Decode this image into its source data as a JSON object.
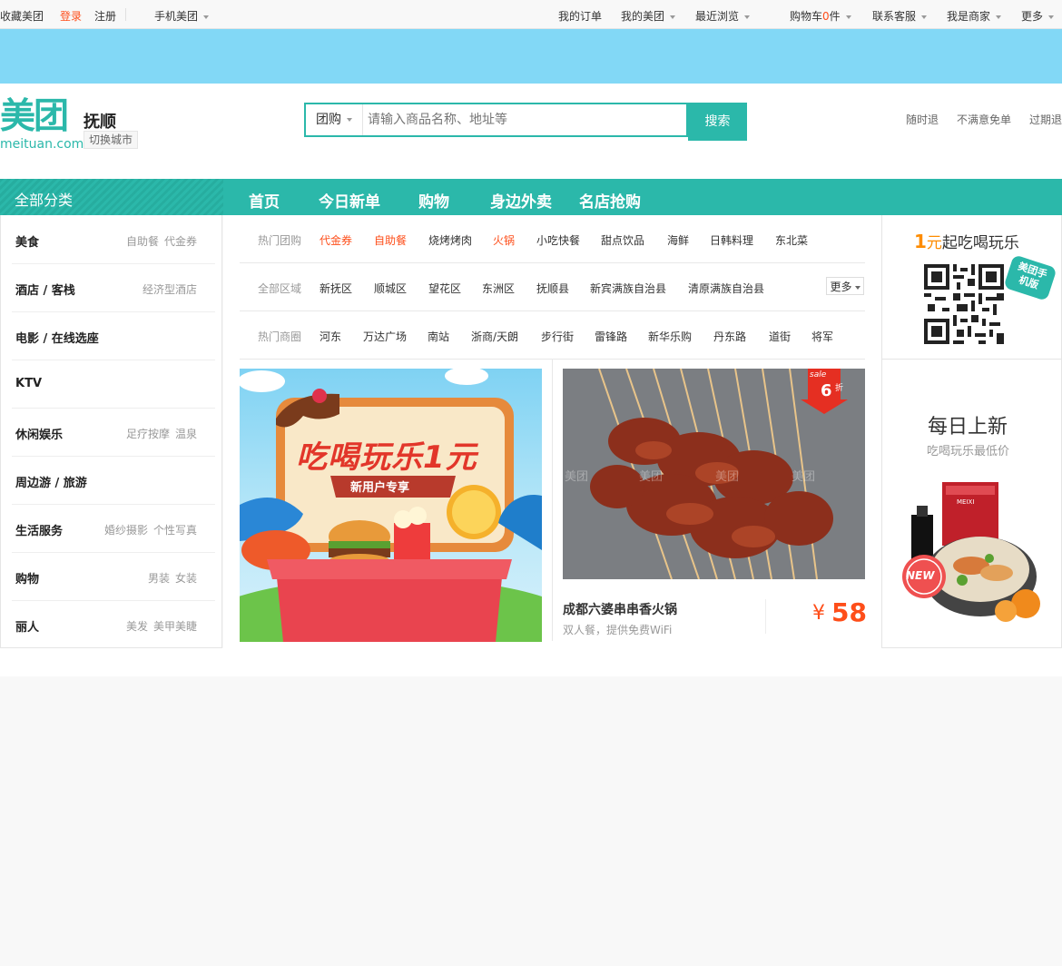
{
  "topbar": {
    "favorite": "收藏美团",
    "login": "登录",
    "register": "注册",
    "mobile": "手机美团",
    "orders": "我的订单",
    "my_meituan": "我的美团",
    "recent": "最近浏览",
    "cart_prefix": "购物车",
    "cart_count": "0",
    "cart_suffix": "件",
    "service": "联系客服",
    "merchant": "我是商家",
    "more": "更多"
  },
  "header": {
    "logo_cn": "美团",
    "logo_en": "meituan.com",
    "city": "抚顺",
    "switch_city": "切换城市",
    "search_type": "团购",
    "search_placeholder": "请输入商品名称、地址等",
    "search_button": "搜索",
    "promises": [
      "随时退",
      "不满意免单",
      "过期退"
    ]
  },
  "nav": {
    "all_categories": "全部分类",
    "items": [
      "首页",
      "今日新单",
      "购物",
      "身边外卖",
      "名店抢购"
    ]
  },
  "categories": [
    {
      "name": "美食",
      "subs": [
        "自助餐",
        "代金券"
      ]
    },
    {
      "name": "酒店 / 客栈",
      "subs": [
        "经济型酒店"
      ]
    },
    {
      "name": "电影 / 在线选座",
      "subs": []
    },
    {
      "name": "KTV",
      "subs": []
    },
    {
      "name": "休闲娱乐",
      "subs": [
        "足疗按摩",
        "温泉"
      ]
    },
    {
      "name": "周边游 / 旅游",
      "subs": []
    },
    {
      "name": "生活服务",
      "subs": [
        "婚纱摄影",
        "个性写真"
      ]
    },
    {
      "name": "购物",
      "subs": [
        "男装",
        "女装"
      ]
    },
    {
      "name": "丽人",
      "subs": [
        "美发",
        "美甲美睫"
      ]
    }
  ],
  "filters": {
    "hot_deals": {
      "label": "热门团购",
      "items": [
        "代金券",
        "自助餐",
        "烧烤烤肉",
        "火锅",
        "小吃快餐",
        "甜点饮品",
        "海鲜",
        "日韩料理",
        "东北菜"
      ]
    },
    "areas": {
      "label": "全部区域",
      "items": [
        "新抚区",
        "顺城区",
        "望花区",
        "东洲区",
        "抚顺县",
        "新宾满族自治县",
        "清原满族自治县"
      ],
      "more": "更多"
    },
    "districts": {
      "label": "热门商圈",
      "items": [
        "河东",
        "万达广场",
        "南站",
        "浙商/天朗",
        "步行街",
        "雷锋路",
        "新华乐购",
        "丹东路",
        "道街",
        "将军"
      ]
    }
  },
  "promo": {
    "title": "吃喝玩乐1元",
    "subtitle": "新用户专享"
  },
  "deal": {
    "badge_sale": "sale",
    "badge_discount": "6",
    "badge_unit": "折",
    "watermark": "美团",
    "title": "成都六婆串串香火锅",
    "desc": "双人餐，提供免费WiFi",
    "currency": "¥",
    "price": "58"
  },
  "right": {
    "promo_num": "1",
    "promo_unit": "元",
    "promo_text": "起吃喝玩乐",
    "mobile_tag": "美团手机版",
    "daily_title": "每日上新",
    "daily_sub": "吃喝玩乐最低价",
    "new_badge": "NEW",
    "product_label": "MEIXI"
  }
}
